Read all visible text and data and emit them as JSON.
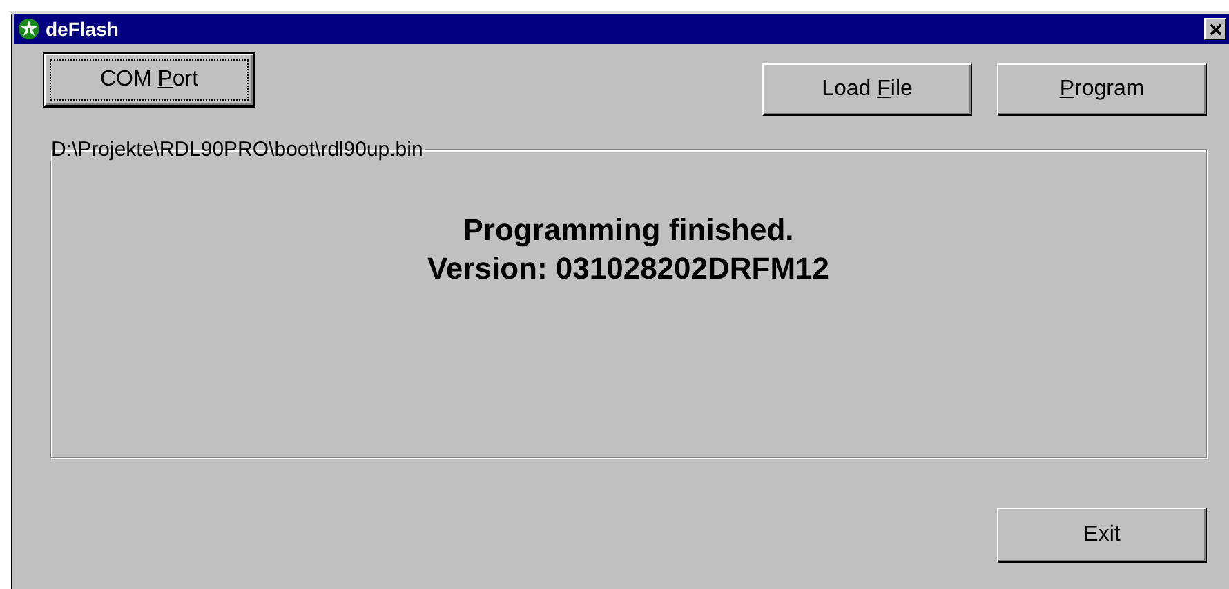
{
  "window": {
    "title": "deFlash"
  },
  "top_buttons": [
    {
      "before": "COM ",
      "mnemonic": "P",
      "after": "ort",
      "focused": true
    },
    {
      "before": "Load ",
      "mnemonic": "F",
      "after": "ile",
      "focused": false
    },
    {
      "mnemonic": "P",
      "after": "rogram",
      "focused": false
    }
  ],
  "group": {
    "title": "D:\\Projekte\\RDL90PRO\\boot\\rdl90up.bin",
    "lines": [
      "Programming finished.",
      "Version: 031028202DRFM12"
    ]
  },
  "exit_button": {
    "label": "Exit"
  }
}
